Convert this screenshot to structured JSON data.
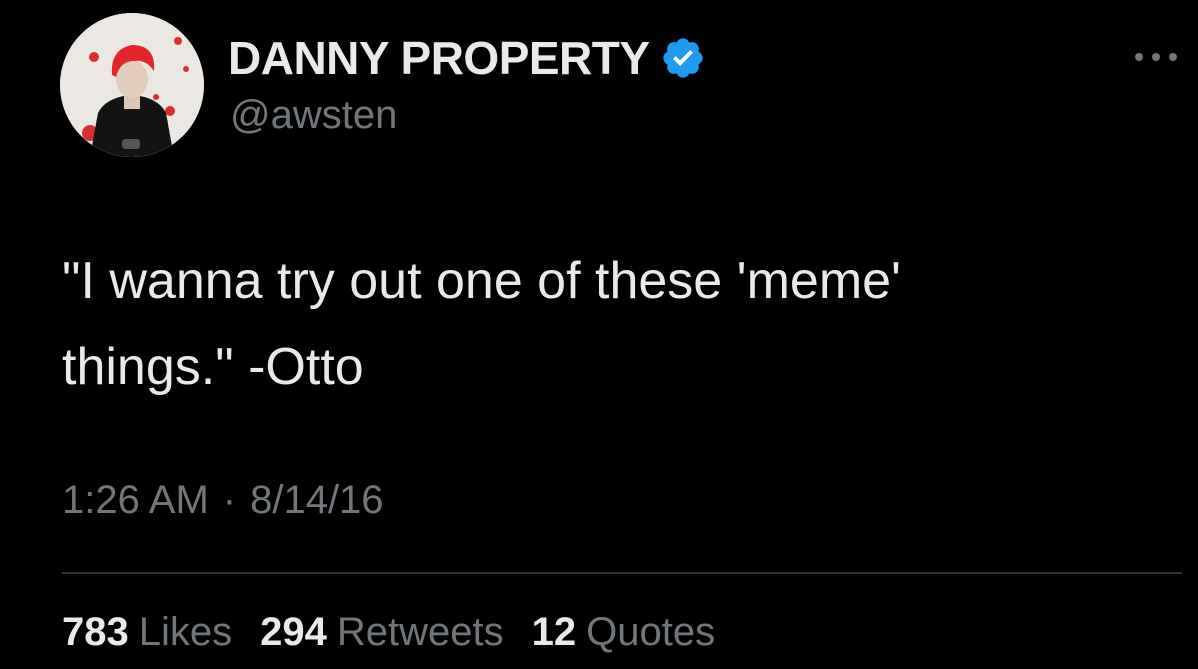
{
  "tweet": {
    "author": {
      "display_name": "DANNY PROPERTY",
      "handle": "@awsten",
      "verified": true,
      "avatar_icon": "profile-photo",
      "verified_icon": "verified-badge-icon"
    },
    "more_icon": "more-options-icon",
    "text": "\"I wanna try out one of these 'meme'\nthings.\" -Otto",
    "time": "1:26 AM",
    "separator": "·",
    "date": "8/14/16",
    "stats": {
      "likes_count": "783",
      "likes_label": "Likes",
      "retweets_count": "294",
      "retweets_label": "Retweets",
      "quotes_count": "12",
      "quotes_label": "Quotes"
    }
  },
  "colors": {
    "background": "#000000",
    "primary_text": "#e7e9ea",
    "secondary_text": "#71767b",
    "divider": "#2f3336",
    "verified_blue": "#1d9bf0"
  }
}
